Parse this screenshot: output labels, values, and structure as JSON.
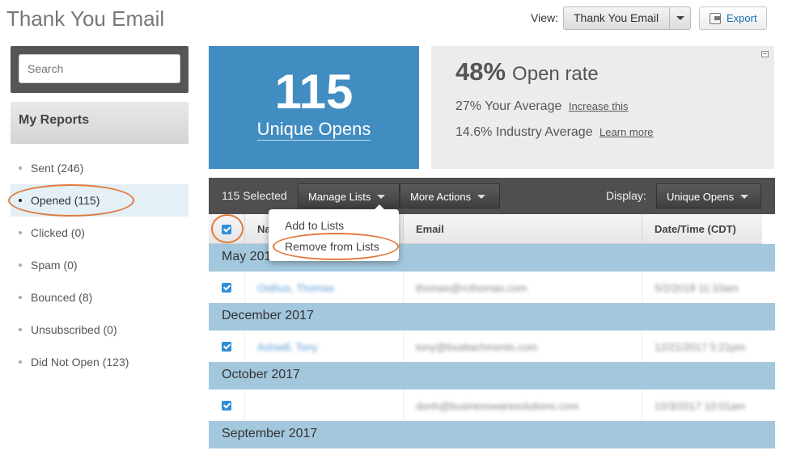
{
  "header": {
    "title": "Thank You Email",
    "view_label": "View:",
    "view_selected": "Thank You Email",
    "export_label": "Export"
  },
  "sidebar": {
    "search_placeholder": "Search",
    "section_title": "My Reports",
    "items": [
      {
        "label": "Sent (246)",
        "active": false
      },
      {
        "label": "Opened (115)",
        "active": true
      },
      {
        "label": "Clicked (0)",
        "active": false
      },
      {
        "label": "Spam (0)",
        "active": false
      },
      {
        "label": "Bounced (8)",
        "active": false
      },
      {
        "label": "Unsubscribed (0)",
        "active": false
      },
      {
        "label": "Did Not Open (123)",
        "active": false
      }
    ]
  },
  "stats": {
    "unique_opens_value": "115",
    "unique_opens_label": "Unique Opens",
    "open_rate_value": "48%",
    "open_rate_label": "Open rate",
    "your_average_text": "27% Your Average",
    "your_average_link": "Increase this",
    "industry_average_text": "14.6% Industry Average",
    "industry_average_link": "Learn more"
  },
  "toolbar": {
    "selected_count": "115 Selected",
    "manage_lists_label": "Manage Lists",
    "more_actions_label": "More Actions",
    "display_label": "Display:",
    "display_selected": "Unique Opens"
  },
  "manage_lists_menu": {
    "items": [
      "Add to Lists",
      "Remove from Lists"
    ]
  },
  "table": {
    "columns": [
      "Na",
      "Email",
      "Date/Time (CDT)"
    ],
    "groups": [
      {
        "label": "May 2018",
        "rows": [
          {
            "name": "Osthus, Thomas",
            "email": "thomas@rcthomas.com",
            "date": "5/2/2018 11:10am"
          }
        ]
      },
      {
        "label": "December 2017",
        "rows": [
          {
            "name": "Ashwill, Tony",
            "email": "tony@bxattachments.com",
            "date": "12/21/2017 5:21pm"
          }
        ]
      },
      {
        "label": "October 2017",
        "rows": [
          {
            "name": "",
            "email": "donh@businesswaresolutions.com",
            "date": "10/3/2017 10:01am"
          }
        ]
      },
      {
        "label": "September 2017",
        "rows": []
      }
    ]
  },
  "colors": {
    "accent_blue": "#418cc0",
    "group_row": "#a3c7dd",
    "highlight_ring": "#e07a3c",
    "toolbar_bg": "#4f4f4f"
  }
}
